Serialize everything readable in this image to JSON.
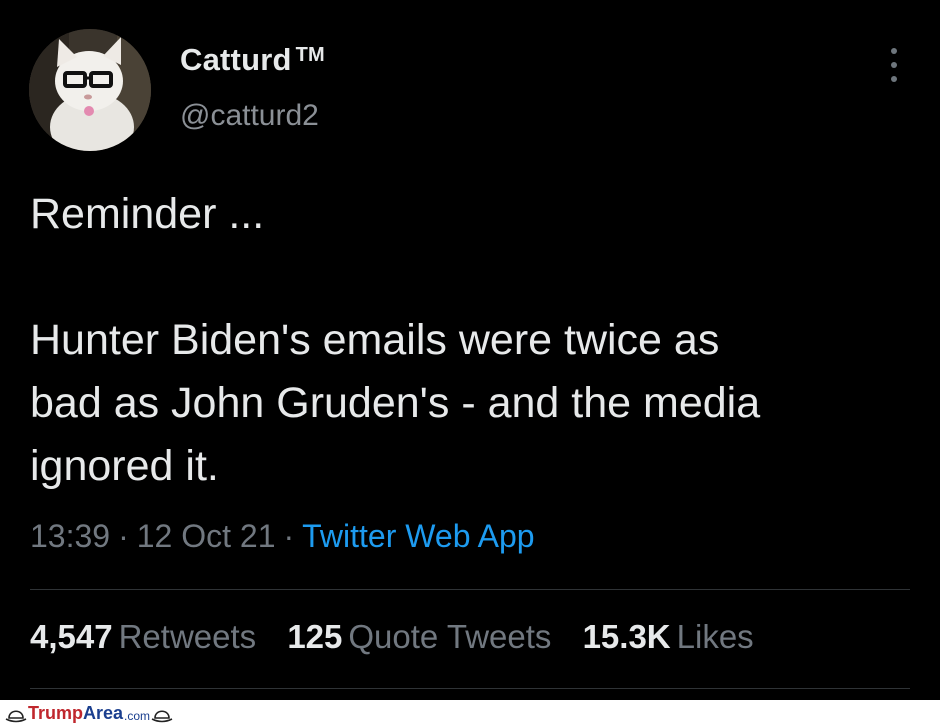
{
  "tweet": {
    "display_name": "Catturd",
    "trademark": "TM",
    "handle": "@catturd2",
    "text_lines": [
      "Reminder ...",
      "",
      "Hunter Biden's emails were twice as",
      "bad as John Gruden's - and the media",
      "ignored it."
    ],
    "time": "13:39",
    "separator": "·",
    "date": "12 Oct 21",
    "source": "Twitter Web App",
    "stats": [
      {
        "num": "4,547",
        "label": "Retweets"
      },
      {
        "num": "125",
        "label": "Quote Tweets"
      },
      {
        "num": "15.3K",
        "label": "Likes"
      }
    ]
  },
  "watermark": {
    "part1": "Trump",
    "part2": "Area",
    "domain": ".com"
  },
  "colors": {
    "background": "#000000",
    "text": "#e7e9ea",
    "muted": "#717880",
    "link": "#1d9bf0"
  },
  "icons": [
    "more-vertical-icon",
    "hat-icon"
  ]
}
